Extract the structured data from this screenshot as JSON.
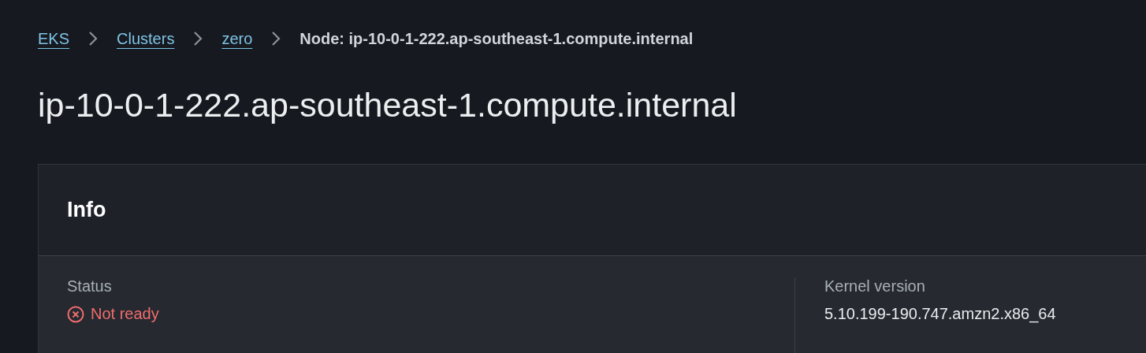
{
  "breadcrumbs": [
    {
      "label": "EKS",
      "kind": "link"
    },
    {
      "label": "Clusters",
      "kind": "link"
    },
    {
      "label": "zero",
      "kind": "link"
    },
    {
      "label": "Node: ip-10-0-1-222.ap-southeast-1.compute.internal",
      "kind": "current"
    }
  ],
  "title": "ip-10-0-1-222.ap-southeast-1.compute.internal",
  "panel": {
    "title": "Info",
    "fields": [
      {
        "label": "Status",
        "value": "Not ready",
        "kind": "error"
      },
      {
        "label": "Kernel version",
        "value": "5.10.199-190.747.amzn2.x86_64",
        "kind": "text"
      }
    ]
  }
}
